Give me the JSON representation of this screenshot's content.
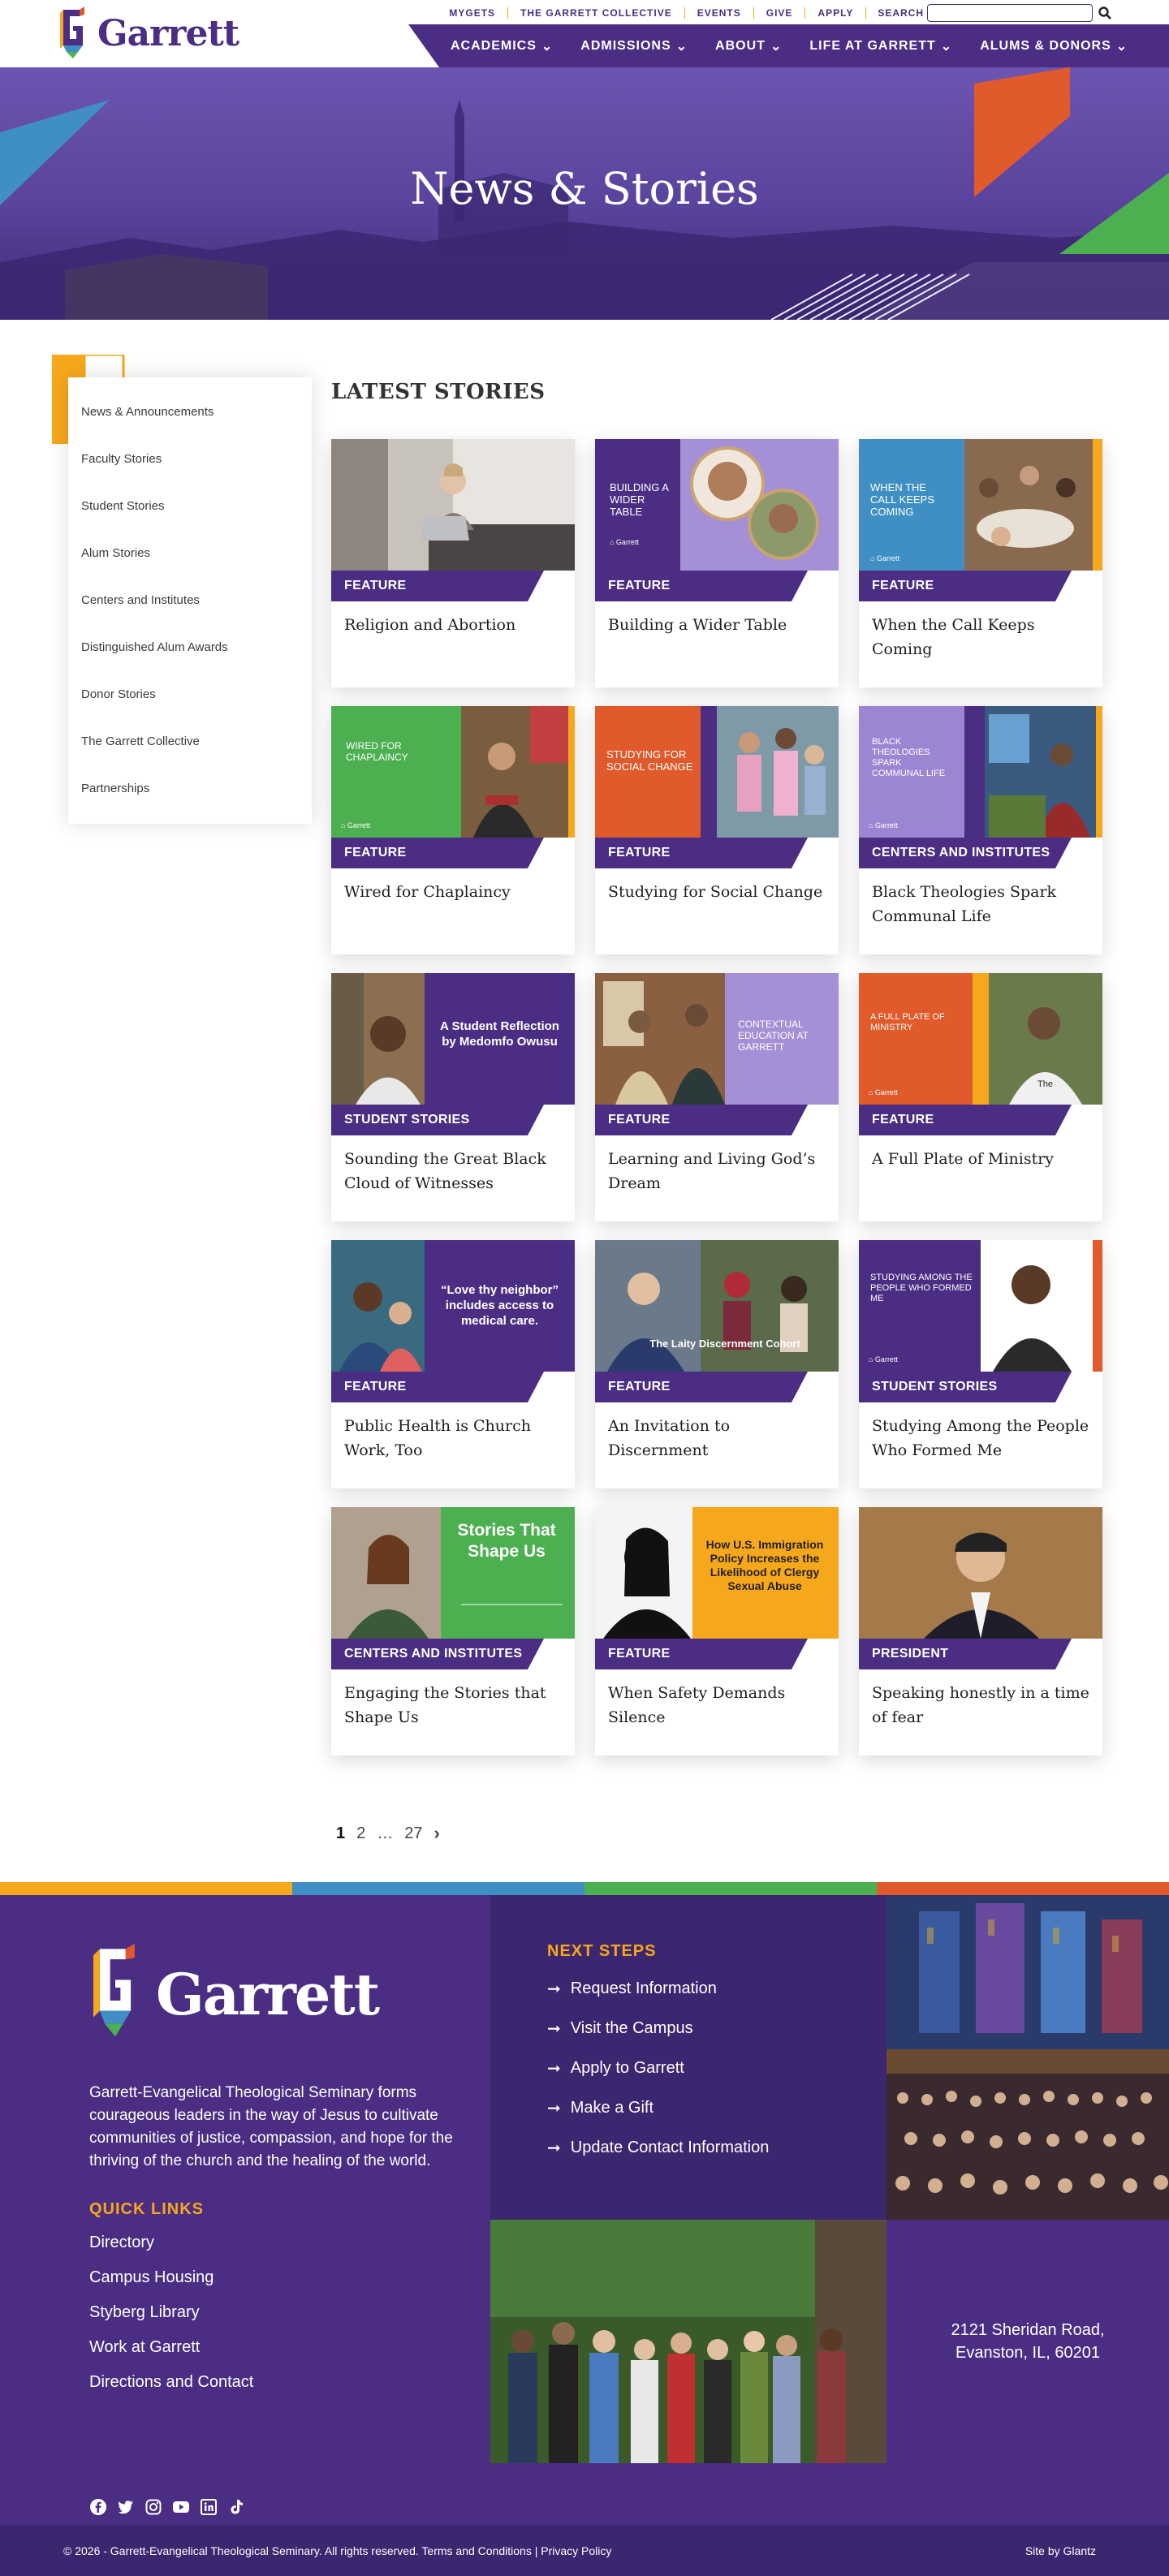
{
  "site": {
    "name": "Garrett"
  },
  "utility_nav": [
    "MYGETS",
    "THE GARRETT COLLECTIVE",
    "EVENTS",
    "GIVE",
    "APPLY"
  ],
  "search": {
    "label": "SEARCH",
    "placeholder": "",
    "value": ""
  },
  "main_nav": [
    "ACADEMICS",
    "ADMISSIONS",
    "ABOUT",
    "LIFE AT GARRETT",
    "ALUMS & DONORS"
  ],
  "hero": {
    "title": "News & Stories"
  },
  "sidebar": {
    "items": [
      "News & Announcements",
      "Faculty Stories",
      "Student Stories",
      "Alum Stories",
      "Centers and Institutes",
      "Distinguished Alum Awards",
      "Donor Stories",
      "The Garrett Collective",
      "Partnerships"
    ]
  },
  "latest": {
    "heading": "LATEST STORIES"
  },
  "cards": [
    {
      "category": "FEATURE",
      "title": "Religion and Abortion",
      "image_text": ""
    },
    {
      "category": "FEATURE",
      "title": "Building a Wider Table",
      "image_text": "BUILDING A WIDER TABLE"
    },
    {
      "category": "FEATURE",
      "title": "When the Call Keeps Coming",
      "image_text": "WHEN THE CALL KEEPS COMING"
    },
    {
      "category": "FEATURE",
      "title": "Wired for Chaplaincy",
      "image_text": "WIRED FOR CHAPLAINCY"
    },
    {
      "category": "FEATURE",
      "title": "Studying for Social Change",
      "image_text": "STUDYING FOR SOCIAL CHANGE"
    },
    {
      "category": "CENTERS AND INSTITUTES",
      "title": "Black Theologies Spark Communal Life",
      "image_text": "BLACK THEOLOGIES SPARK COMMUNAL LIFE"
    },
    {
      "category": "STUDENT STORIES",
      "title": "Sounding the Great Black Cloud of Witnesses",
      "image_text": "A Student Reflection by Medomfo Owusu"
    },
    {
      "category": "FEATURE",
      "title": "Learning and Living God’s Dream",
      "image_text": "CONTEXTUAL EDUCATION AT GARRETT"
    },
    {
      "category": "FEATURE",
      "title": "A Full Plate of Ministry",
      "image_text": "A FULL PLATE OF MINISTRY"
    },
    {
      "category": "FEATURE",
      "title": "Public Health is Church Work, Too",
      "image_text": "“Love thy neighbor” includes access to medical care."
    },
    {
      "category": "FEATURE",
      "title": "An Invitation to Discernment",
      "image_text": "The Laity Discernment Cohort"
    },
    {
      "category": "STUDENT STORIES",
      "title": "Studying Among the People Who Formed Me",
      "image_text": "STUDYING AMONG THE PEOPLE WHO FORMED ME"
    },
    {
      "category": "CENTERS AND INSTITUTES",
      "title": "Engaging the Stories that Shape Us",
      "image_text": "Stories That Shape Us"
    },
    {
      "category": "FEATURE",
      "title": "When Safety Demands Silence",
      "image_text": "How U.S. Immigration Policy Increases the Likelihood of Clergy Sexual Abuse"
    },
    {
      "category": "PRESIDENT",
      "title": "Speaking honestly in a time of fear",
      "image_text": ""
    }
  ],
  "pagination": {
    "current": "1",
    "next_page": "2",
    "ellipsis": "…",
    "last": "27"
  },
  "footer": {
    "description": "Garrett-Evangelical Theological Seminary forms courageous leaders in the way of Jesus to cultivate communities of justice, compassion, and hope for the thriving of the church and the healing of the world.",
    "quick_links_heading": "QUICK LINKS",
    "quick_links": [
      "Directory",
      "Campus Housing",
      "Styberg Library",
      "Work at Garrett",
      "Directions and Contact"
    ],
    "next_steps_heading": "NEXT STEPS",
    "next_steps": [
      "Request Information",
      "Visit the Campus",
      "Apply to Garrett",
      "Make a Gift",
      "Update Contact Information"
    ],
    "address_line1": "2121 Sheridan Road,",
    "address_line2": "Evanston, IL, 60201",
    "social": [
      "facebook-icon",
      "twitter-icon",
      "instagram-icon",
      "youtube-icon",
      "linkedin-icon",
      "tiktok-icon"
    ]
  },
  "bottom_bar": {
    "copyright": "© 2026 - Garrett-Evangelical Theological Seminary. All rights reserved.",
    "terms": "Terms and Conditions",
    "separator": "|",
    "privacy": "Privacy Policy",
    "credit": "Site by Glantz"
  },
  "colors": {
    "purple": "#4b2e83",
    "dark_purple": "#3d2670",
    "gold": "#f6a81c",
    "orange": "#e05a2b",
    "green": "#4caf50",
    "blue": "#3f8fc4"
  }
}
